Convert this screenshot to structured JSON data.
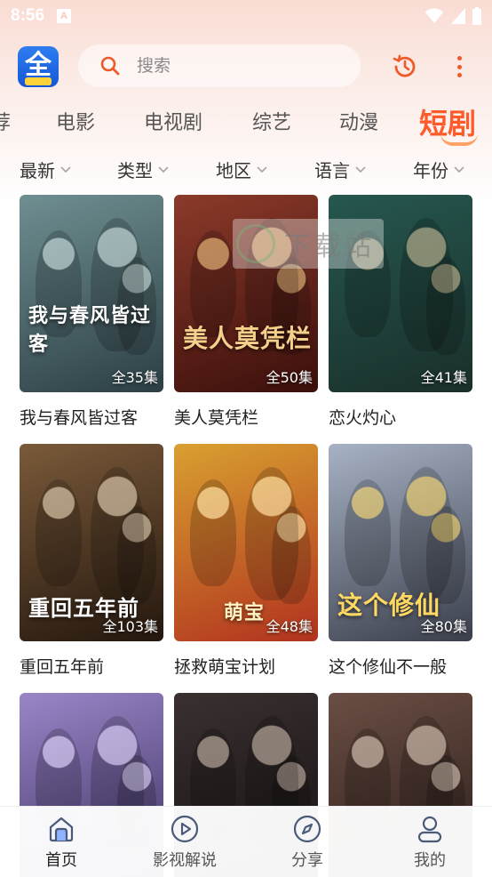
{
  "status": {
    "time": "8:56",
    "notif_letter": "A"
  },
  "header": {
    "logo_glyph": "全",
    "search_placeholder": "搜索"
  },
  "tabs": [
    {
      "label": "荐"
    },
    {
      "label": "电影"
    },
    {
      "label": "电视剧"
    },
    {
      "label": "综艺"
    },
    {
      "label": "动漫"
    },
    {
      "label": "短剧",
      "active": true
    }
  ],
  "filters": [
    {
      "label": "最新"
    },
    {
      "label": "类型"
    },
    {
      "label": "地区"
    },
    {
      "label": "语言"
    },
    {
      "label": "年份"
    }
  ],
  "watermark": "下载站",
  "items": [
    {
      "title": "我与春风皆过客",
      "episodes": "全35集",
      "poster_text": "我与春风皆过客",
      "bg": [
        "#6f8f91",
        "#2c3f44"
      ],
      "art": "#d7e6e6"
    },
    {
      "title": "美人莫凭栏",
      "episodes": "全50集",
      "poster_text": "美人莫凭栏",
      "bg": [
        "#8b3a2a",
        "#3b0f0b"
      ],
      "art": "#f4d08a"
    },
    {
      "title": "恋火灼心",
      "episodes": "全41集",
      "poster_text": "",
      "bg": [
        "#26574f",
        "#1a2f2b"
      ],
      "art": "#d9c39a"
    },
    {
      "title": "重回五年前",
      "episodes": "全103集",
      "poster_text": "重回五年前",
      "bg": [
        "#7a5a3a",
        "#24170e"
      ],
      "art": "#f2e2c6"
    },
    {
      "title": "拯救萌宝计划",
      "episodes": "全48集",
      "poster_text": "萌宝",
      "bg": [
        "#d9a030",
        "#b1321f"
      ],
      "art": "#fff2c0"
    },
    {
      "title": "这个修仙不一般",
      "episodes": "全80集",
      "poster_text": "这个修仙",
      "bg": [
        "#a7b2c4",
        "#3b3f4c"
      ],
      "art": "#ffd860"
    },
    {
      "title": "",
      "episodes": "",
      "poster_text": "",
      "bg": [
        "#9a86c8",
        "#3a2e5d"
      ],
      "art": "#e9e0ff"
    },
    {
      "title": "",
      "episodes": "",
      "poster_text": "",
      "bg": [
        "#3a3030",
        "#141010"
      ],
      "art": "#d8c8b8"
    },
    {
      "title": "",
      "episodes": "",
      "poster_text": "",
      "bg": [
        "#6a4e44",
        "#2a1c18"
      ],
      "art": "#e8d8c8"
    }
  ],
  "bottom_nav": [
    {
      "label": "首页",
      "icon": "home-icon",
      "active": true
    },
    {
      "label": "影视解说",
      "icon": "play-circle-icon"
    },
    {
      "label": "分享",
      "icon": "compass-icon"
    },
    {
      "label": "我的",
      "icon": "user-icon"
    }
  ],
  "colors": {
    "accent": "#ff5a2a",
    "icon_orange": "#ee5a2a"
  }
}
